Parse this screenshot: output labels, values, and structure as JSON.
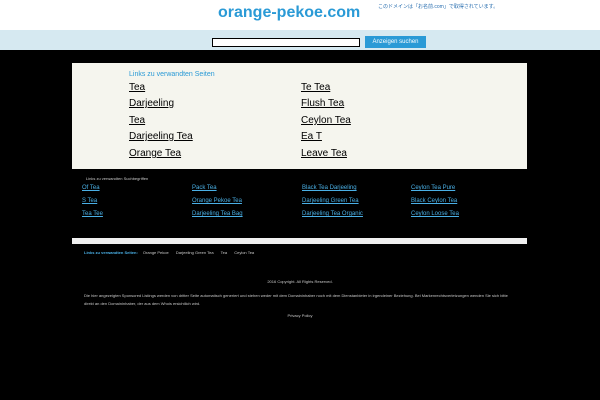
{
  "header": {
    "domain": "orange-pekoe.com",
    "jp_notice": "このドメインは「お名前.com」で取得されています。"
  },
  "search": {
    "input_value": "",
    "button_label": "Anzeigen suchen"
  },
  "related_panel": {
    "heading": "Links zu verwandten Seiten",
    "left_links": [
      "Tea",
      "Darjeeling",
      "Tea",
      "Darjeeling Tea",
      "Orange Tea"
    ],
    "right_links": [
      "Te Tea",
      "Flush Tea",
      "Ceylon Tea",
      "Ea T",
      "Leave Tea"
    ]
  },
  "topics": {
    "heading": "Links zu verwandten Suchbegriffen",
    "columns": [
      [
        "Of Tea",
        "S Tea",
        "Tea Tee"
      ],
      [
        "Pack Tea",
        "Orange Pekoe Tea",
        "Darjeeling Tea Bag"
      ],
      [
        "Black Tea Darjeeling",
        "Darjeeling Green Tea",
        "Darjeeling Tea Organic"
      ],
      [
        "Ceylon Tea Pure",
        "Black Ceylon Tea",
        "Ceylon Loose Tea"
      ]
    ]
  },
  "footer": {
    "related_label": "Links zu verwandten Seiten:",
    "related_links": [
      "Orange Pekoe",
      "Darjeeling Green Tea",
      "Tea",
      "Ceylon Tea"
    ],
    "copyright": "2016 Copyright. All Rights Reserved.",
    "disclaimer": "Die hier angezeigten Sponsored Listings werden von dritter Seite automatisch generiert und stehen weder mit dem Domaininhaber noch mit dem Dienstanbieter in irgendeiner Beziehung. Bei Markenrechtsverletzungen wenden Sie sich bitte direkt an den Domaininhaber, der aus dem Whois ersichtlich wird.",
    "privacy": "Privacy Policy"
  },
  "colors": {
    "accent": "#2a9ad6",
    "search_band": "#d6e9f1",
    "panel_bg": "#f5f5ee",
    "topic_link": "#4ab0e6"
  }
}
